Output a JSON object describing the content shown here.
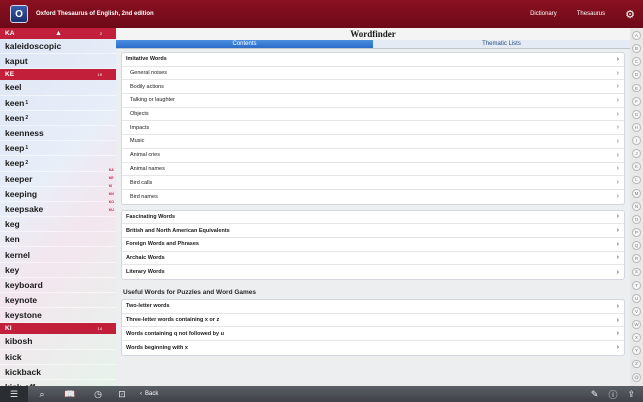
{
  "app": {
    "title": "Oxford Thesaurus of English, 2nd edition",
    "logo_letter": "O",
    "nav": [
      "Dictionary",
      "Thesaurus"
    ]
  },
  "sidebar": {
    "sections": [
      {
        "head": "KA",
        "count": "2",
        "words": [
          {
            "w": "kaleidoscopic",
            "sup": ""
          },
          {
            "w": "kaput",
            "sup": ""
          }
        ]
      },
      {
        "head": "KE",
        "count": "19",
        "words": [
          {
            "w": "keel",
            "sup": ""
          },
          {
            "w": "keen",
            "sup": "1"
          },
          {
            "w": "keen",
            "sup": "2"
          },
          {
            "w": "keenness",
            "sup": ""
          },
          {
            "w": "keep",
            "sup": "1"
          },
          {
            "w": "keep",
            "sup": "2"
          },
          {
            "w": "keeper",
            "sup": ""
          },
          {
            "w": "keeping",
            "sup": ""
          },
          {
            "w": "keepsake",
            "sup": ""
          },
          {
            "w": "keg",
            "sup": ""
          },
          {
            "w": "ken",
            "sup": ""
          },
          {
            "w": "kernel",
            "sup": ""
          },
          {
            "w": "key",
            "sup": ""
          },
          {
            "w": "keyboard",
            "sup": ""
          },
          {
            "w": "keynote",
            "sup": ""
          },
          {
            "w": "keystone",
            "sup": ""
          }
        ]
      },
      {
        "head": "KI",
        "count": "14",
        "words": [
          {
            "w": "kibosh",
            "sup": ""
          },
          {
            "w": "kick",
            "sup": ""
          },
          {
            "w": "kickback",
            "sup": ""
          },
          {
            "w": "kick-off",
            "sup": ""
          }
        ]
      }
    ],
    "index_marks": [
      "KA",
      "KE",
      "KI",
      "KN",
      "KO",
      "KU"
    ]
  },
  "main": {
    "title": "Wordfinder",
    "tabs": [
      "Contents",
      "Thematic Lists"
    ],
    "group1": [
      {
        "label": "Imitative Words",
        "bold": true
      },
      {
        "label": "General noises"
      },
      {
        "label": "Bodily actions"
      },
      {
        "label": "Talking or laughter"
      },
      {
        "label": "Objects"
      },
      {
        "label": "Impacts"
      },
      {
        "label": "Music"
      },
      {
        "label": "Animal cries"
      },
      {
        "label": "Animal names"
      },
      {
        "label": "Bird calls"
      },
      {
        "label": "Bird names"
      }
    ],
    "group2": [
      "Fascinating Words",
      "British and North American Equivalents",
      "Foreign Words and Phrases",
      "Archaic Words",
      "Literary Words"
    ],
    "puzzles_head": "Useful Words for Puzzles and Word Games",
    "group3": [
      "Two-letter words",
      "Three-letter words containing x or z",
      "Words containing q not followed by u",
      "Words beginning with x"
    ]
  },
  "alphabet": [
    "A",
    "B",
    "C",
    "D",
    "E",
    "F",
    "G",
    "H",
    "I",
    "J",
    "K",
    "L",
    "M",
    "N",
    "O",
    "P",
    "Q",
    "R",
    "S",
    "T",
    "U",
    "V",
    "W",
    "X",
    "Y",
    "Z",
    "@"
  ],
  "toolbar": {
    "back_label": "Back"
  }
}
